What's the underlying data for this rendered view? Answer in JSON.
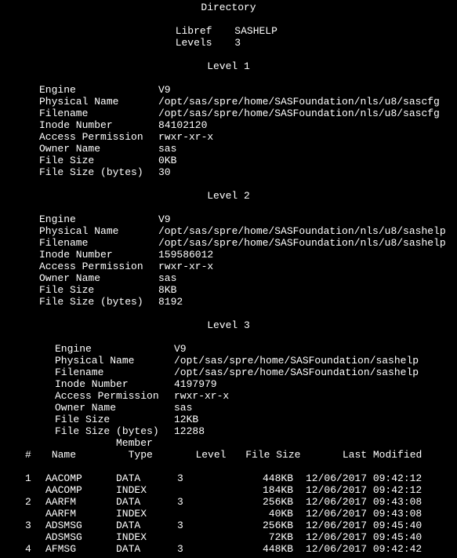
{
  "title": "Directory",
  "libref_label": "Libref",
  "libref_value": "SASHELP",
  "levels_label": "Levels",
  "levels_value": "3",
  "labels": {
    "engine": "Engine",
    "physical_name": "Physical Name",
    "filename": "Filename",
    "inode": "Inode Number",
    "access": "Access Permission",
    "owner": "Owner Name",
    "filesize": "File Size",
    "filesize_bytes": "File Size (bytes)"
  },
  "level1": {
    "heading": "Level 1",
    "engine": "V9",
    "physical_name": "/opt/sas/spre/home/SASFoundation/nls/u8/sascfg",
    "filename": "/opt/sas/spre/home/SASFoundation/nls/u8/sascfg",
    "inode": "84102120",
    "access": "rwxr-xr-x",
    "owner": "sas",
    "filesize": "0KB",
    "filesize_bytes": "30"
  },
  "level2": {
    "heading": "Level 2",
    "engine": "V9",
    "physical_name": "/opt/sas/spre/home/SASFoundation/nls/u8/sashelp",
    "filename": "/opt/sas/spre/home/SASFoundation/nls/u8/sashelp",
    "inode": "159586012",
    "access": "rwxr-xr-x",
    "owner": "sas",
    "filesize": "8KB",
    "filesize_bytes": "8192"
  },
  "level3": {
    "heading": "Level 3",
    "engine": "V9",
    "physical_name": "/opt/sas/spre/home/SASFoundation/sashelp",
    "filename": "/opt/sas/spre/home/SASFoundation/sashelp",
    "inode": "4197979",
    "access": "rwxr-xr-x",
    "owner": "sas",
    "filesize": "12KB",
    "filesize_bytes": "12288"
  },
  "table": {
    "member_header": "Member",
    "headers": {
      "num": "#",
      "name": "Name",
      "type": "Type",
      "level": "Level",
      "filesize": "File Size",
      "modified": "Last Modified"
    },
    "rows": [
      {
        "num": "1",
        "name": "AACOMP",
        "type": "DATA",
        "level": "3",
        "size": "448KB",
        "mod": "12/06/2017 09:42:12"
      },
      {
        "num": "",
        "name": "AACOMP",
        "type": "INDEX",
        "level": "",
        "size": "184KB",
        "mod": "12/06/2017 09:42:12"
      },
      {
        "num": "2",
        "name": "AARFM",
        "type": "DATA",
        "level": "3",
        "size": "256KB",
        "mod": "12/06/2017 09:43:08"
      },
      {
        "num": "",
        "name": "AARFM",
        "type": "INDEX",
        "level": "",
        "size": "40KB",
        "mod": "12/06/2017 09:43:08"
      },
      {
        "num": "3",
        "name": "ADSMSG",
        "type": "DATA",
        "level": "3",
        "size": "256KB",
        "mod": "12/06/2017 09:45:40"
      },
      {
        "num": "",
        "name": "ADSMSG",
        "type": "INDEX",
        "level": "",
        "size": "72KB",
        "mod": "12/06/2017 09:45:40"
      },
      {
        "num": "4",
        "name": "AFMSG",
        "type": "DATA",
        "level": "3",
        "size": "448KB",
        "mod": "12/06/2017 09:42:42"
      }
    ]
  }
}
